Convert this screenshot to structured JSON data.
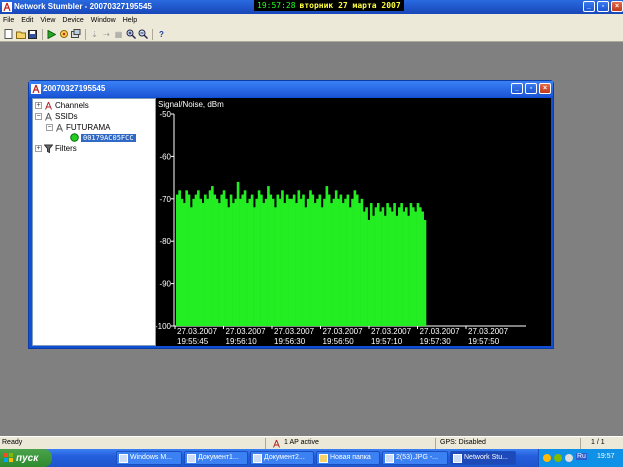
{
  "app": {
    "title": "Network Stumbler - 20070327195545",
    "clock_time": "19:57:28",
    "clock_date": "вторник 27 марта 2007"
  },
  "menu": [
    "File",
    "Edit",
    "View",
    "Device",
    "Window",
    "Help"
  ],
  "toolbar": {
    "icons": [
      "new-icon",
      "open-icon",
      "save-icon",
      "play-icon",
      "scan-icon",
      "options-icon",
      "arrange-icon",
      "arrange-icon-2",
      "tile-icon",
      "zoom-in-icon",
      "zoom-out-icon",
      "help-icon"
    ]
  },
  "child": {
    "title": "20070327195545"
  },
  "tree": {
    "channels": "Channels",
    "ssids": "SSIDs",
    "network": "FUTURAMA",
    "ap": "00179AC05FCC",
    "filters": "Filters"
  },
  "chart_data": {
    "type": "bar",
    "title": "",
    "ylabel": "Signal/Noise, dBm",
    "ylim": [
      -100,
      -50
    ],
    "yticks": [
      -50,
      -60,
      -70,
      -80,
      -90,
      -100
    ],
    "xticks": [
      {
        "date": "27.03.2007",
        "time": "19:55:45"
      },
      {
        "date": "27.03.2007",
        "time": "19:56:10"
      },
      {
        "date": "27.03.2007",
        "time": "19:56:30"
      },
      {
        "date": "27.03.2007",
        "time": "19:56:50"
      },
      {
        "date": "27.03.2007",
        "time": "19:57:10"
      },
      {
        "date": "27.03.2007",
        "time": "19:57:30"
      },
      {
        "date": "27.03.2007",
        "time": "19:57:50"
      }
    ],
    "bar_color": "#22ee22",
    "values": [
      -69,
      -68,
      -70,
      -71,
      -68,
      -69,
      -72,
      -70,
      -69,
      -68,
      -70,
      -71,
      -69,
      -70,
      -68,
      -67,
      -69,
      -70,
      -71,
      -69,
      -68,
      -70,
      -72,
      -69,
      -71,
      -70,
      -66,
      -70,
      -69,
      -68,
      -71,
      -70,
      -69,
      -72,
      -70,
      -68,
      -69,
      -71,
      -70,
      -67,
      -69,
      -70,
      -72,
      -69,
      -70,
      -68,
      -71,
      -69,
      -70,
      -70,
      -69,
      -71,
      -68,
      -70,
      -69,
      -72,
      -70,
      -68,
      -69,
      -71,
      -70,
      -69,
      -72,
      -70,
      -67,
      -69,
      -71,
      -70,
      -68,
      -70,
      -69,
      -71,
      -70,
      -69,
      -72,
      -70,
      -68,
      -69,
      -71,
      -70,
      -73,
      -72,
      -75,
      -71,
      -74,
      -72,
      -71,
      -73,
      -72,
      -74,
      -71,
      -72,
      -73,
      -71,
      -74,
      -72,
      -71,
      -73,
      -72,
      -74,
      -71,
      -72,
      -73,
      -71,
      -72,
      -73,
      -75
    ]
  },
  "statusbar": {
    "ready": "Ready",
    "ap_count": "1 AP active",
    "gps": "GPS: Disabled",
    "page": "1 / 1"
  },
  "taskbar": {
    "start_label": "пуск",
    "tasks": [
      {
        "label": "Windows M...",
        "active": false
      },
      {
        "label": "Документ1...",
        "active": false
      },
      {
        "label": "Документ2...",
        "active": false
      },
      {
        "label": "Новая папка",
        "active": false
      },
      {
        "label": "2(53).JPG -...",
        "active": false
      },
      {
        "label": "Network Stu...",
        "active": true
      }
    ],
    "tray_lang": "Ru",
    "tray_time": "19:57"
  }
}
